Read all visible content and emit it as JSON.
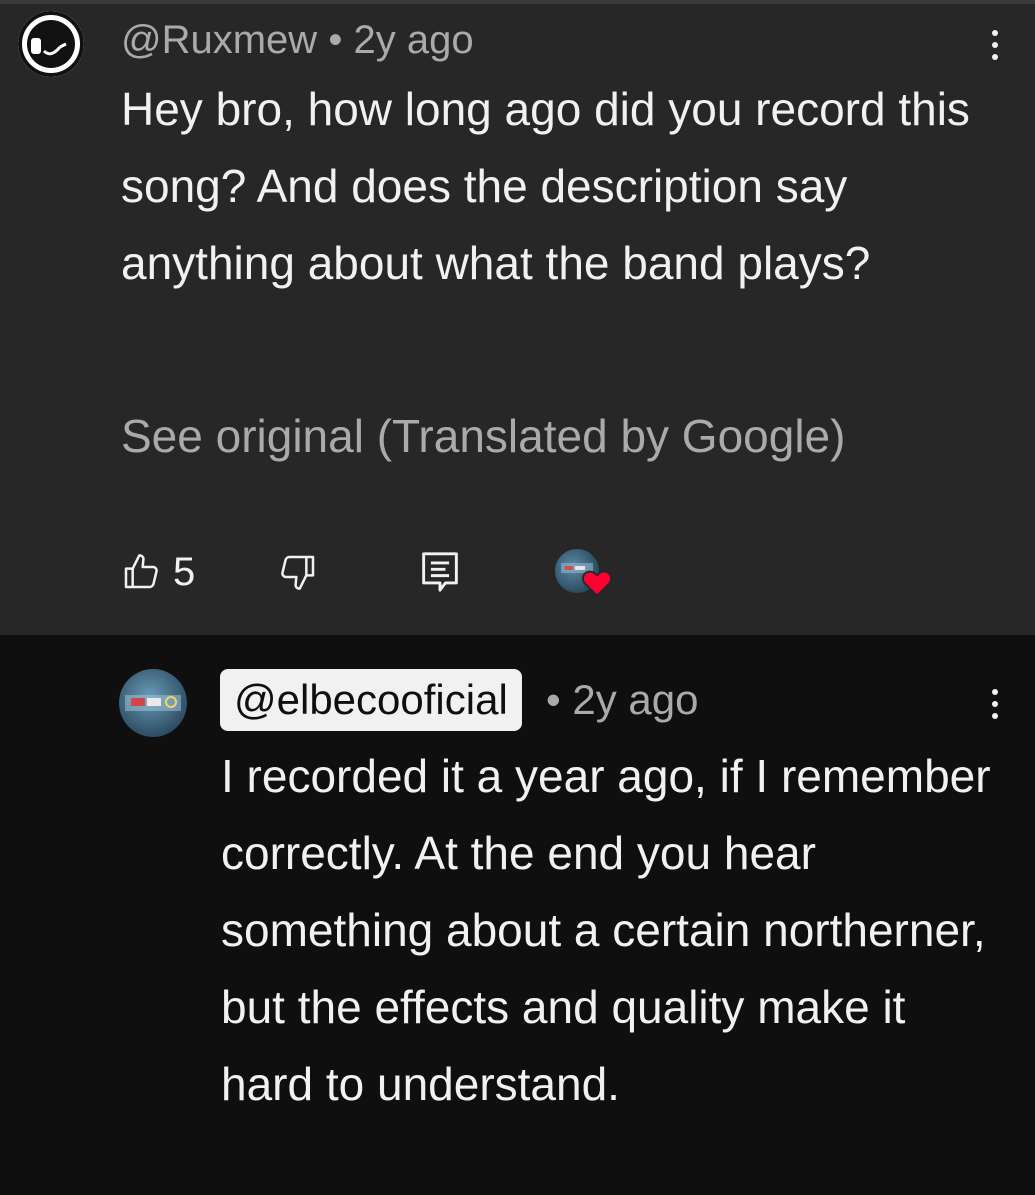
{
  "comment": {
    "handle": "@Ruxmew",
    "separator": "•",
    "time": "2y ago",
    "text": "Hey bro, how long ago did you record this song? And does the description say anything about what the band plays?",
    "translate_link": "See original (Translated by Google)",
    "like_count": "5",
    "icons": {
      "like": "thumbs-up-icon",
      "dislike": "thumbs-down-icon",
      "reply": "reply-icon",
      "more": "more-vert-icon",
      "creator_heart": "creator-heart-icon"
    }
  },
  "reply": {
    "handle": "@elbecooficial",
    "separator": "•",
    "time": "2y ago",
    "text": "I recorded it a year ago, if I remember correctly. At the end you hear something about a certain northerner, but the effects and quality make it hard to understand."
  },
  "colors": {
    "comment_bg": "#272727",
    "reply_bg": "#0f0f0f",
    "secondary_text": "#aaaaaa",
    "heart": "#ff0033"
  }
}
